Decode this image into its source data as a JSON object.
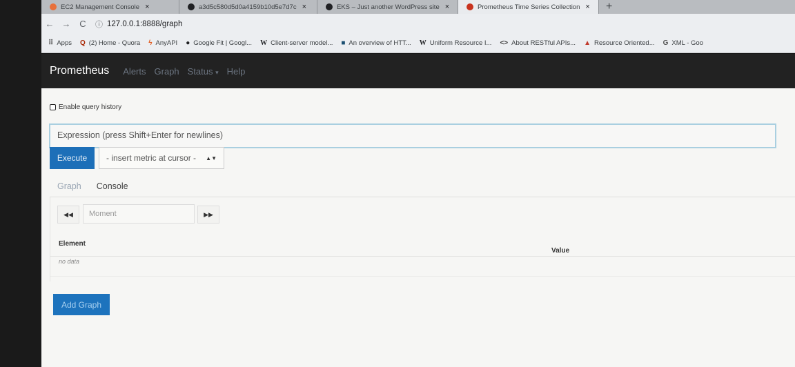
{
  "browser": {
    "tabs": [
      {
        "title": "EC2 Management Console",
        "close": "×",
        "active": false,
        "color": "#e8713c"
      },
      {
        "title": "a3d5c580d5d0a4159b10d5e7d7c",
        "close": "×",
        "active": false,
        "color": "#202124"
      },
      {
        "title": "EKS – Just another WordPress site",
        "close": "×",
        "active": false,
        "color": "#202124"
      },
      {
        "title": "Prometheus Time Series Collection",
        "close": "×",
        "active": true,
        "color": "#c8331e"
      }
    ],
    "new_tab": "+",
    "nav": {
      "back": "←",
      "forward": "→",
      "reload": "C",
      "info": "ⓘ"
    },
    "url": "127.0.0.1:8888/graph",
    "bookmarks": [
      {
        "icon": "⠿",
        "label": "Apps"
      },
      {
        "icon": "Q",
        "label": "(2) Home - Quora"
      },
      {
        "icon": "ϟ",
        "label": "AnyAPI"
      },
      {
        "icon": "●",
        "label": "Google Fit | Googl..."
      },
      {
        "icon": "W",
        "label": "Client-server model..."
      },
      {
        "icon": "■",
        "label": "An overview of HTT..."
      },
      {
        "icon": "W",
        "label": "Uniform Resource I..."
      },
      {
        "icon": "<>",
        "label": "About RESTful APIs..."
      },
      {
        "icon": "▲",
        "label": "Resource Oriented..."
      },
      {
        "icon": "G",
        "label": "XML - Goo"
      }
    ]
  },
  "navbar": {
    "brand": "Prometheus",
    "links": [
      "Alerts",
      "Graph",
      "Status",
      "Help"
    ],
    "status_caret": "▾"
  },
  "query": {
    "history_label": "Enable query history",
    "history_checked": false,
    "expression_placeholder": "Expression (press Shift+Enter for newlines)",
    "execute_label": "Execute",
    "metric_select": "- insert metric at cursor -",
    "select_arrows": "▲▼"
  },
  "tabs": {
    "graph": "Graph",
    "console": "Console"
  },
  "console": {
    "back_icon": "◀◀",
    "forward_icon": "▶▶",
    "moment_placeholder": "Moment",
    "col_element": "Element",
    "col_value": "Value",
    "no_data": "no data"
  },
  "add_graph_label": "Add Graph"
}
